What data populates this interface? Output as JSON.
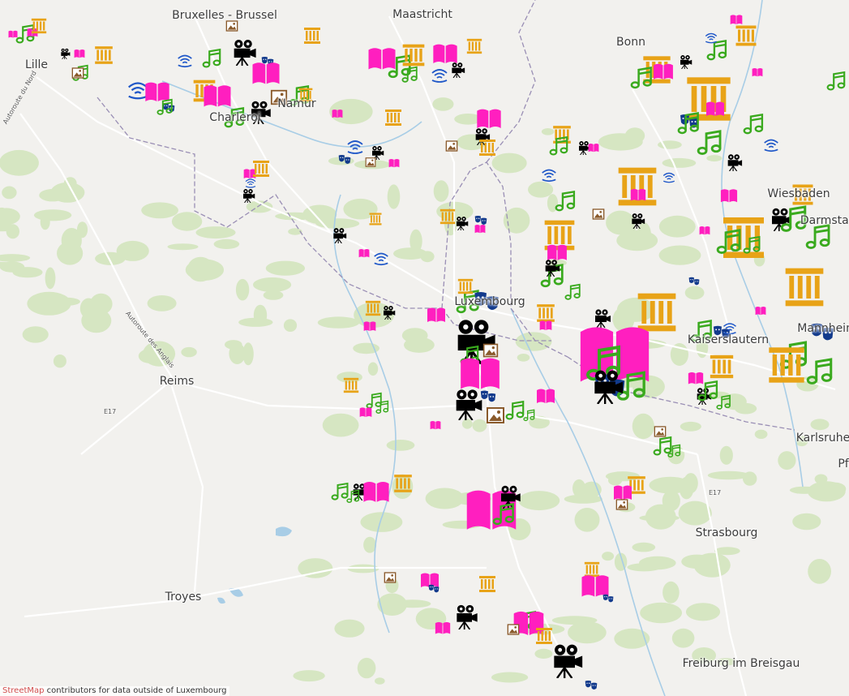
{
  "cities": [
    {
      "key": "bruxelles",
      "label": "Bruxelles - Brussel"
    },
    {
      "key": "maastricht",
      "label": "Maastricht"
    },
    {
      "key": "bonn",
      "label": "Bonn"
    },
    {
      "key": "lille",
      "label": "Lille"
    },
    {
      "key": "wiesbaden",
      "label": "Wiesbaden"
    },
    {
      "key": "luxembourg",
      "label": "Luxembourg"
    },
    {
      "key": "kaiserslautern",
      "label": "Kaiserslautern"
    },
    {
      "key": "mannheim",
      "label": "Mannheim"
    },
    {
      "key": "darmstadt",
      "label": "Darmstadt"
    },
    {
      "key": "reims",
      "label": "Reims"
    },
    {
      "key": "karlsruhe",
      "label": "Karlsruhe"
    },
    {
      "key": "strasbourg",
      "label": "Strasbourg"
    },
    {
      "key": "troyes",
      "label": "Troyes"
    },
    {
      "key": "freiburg",
      "label": "Freiburg im Breisgau"
    },
    {
      "key": "pforzheim",
      "label": "Pf"
    },
    {
      "key": "namur",
      "label": "Namur"
    },
    {
      "key": "charleroi",
      "label": "Charleroi"
    }
  ],
  "road_labels": [
    {
      "key": "a1",
      "label": "Autoroute du Nord"
    },
    {
      "key": "a26",
      "label": "Autoroute des Anglais"
    },
    {
      "key": "e17",
      "label": "E17"
    },
    {
      "key": "e17b",
      "label": "E17"
    }
  ],
  "attribution": {
    "link_text": "StreetMap",
    "rest_text": " contributors for data outside of Luxembourg"
  },
  "legend_categories": [
    {
      "key": "museum",
      "icon": "museum-icon",
      "color": "#e8a317"
    },
    {
      "key": "library",
      "icon": "book-icon",
      "color": "#ff1fbf"
    },
    {
      "key": "music",
      "icon": "music-note-icon",
      "color": "#3aaa1e"
    },
    {
      "key": "cinema",
      "icon": "film-projector-icon",
      "color": "#000000"
    },
    {
      "key": "theatre",
      "icon": "theatre-masks-icon",
      "color": "#123a8c"
    },
    {
      "key": "radio",
      "icon": "radio-waves-icon",
      "color": "#1f57c8"
    },
    {
      "key": "gallery",
      "icon": "gallery-picture-icon",
      "color": "#8a5a2b"
    }
  ],
  "map_colors": {
    "land": "#f2f1ee",
    "forest": "#d6e6c2",
    "water": "#a8cde6",
    "border": "#9a8fb5",
    "road": "#ffffff"
  }
}
